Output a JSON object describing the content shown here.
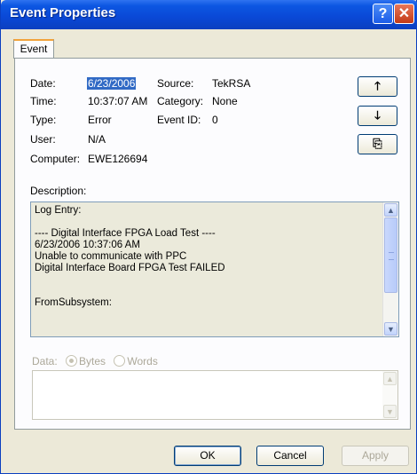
{
  "window": {
    "title": "Event Properties",
    "help_glyph": "?",
    "close_glyph": "✕"
  },
  "tabs": [
    {
      "label": "Event"
    }
  ],
  "event": {
    "date_label": "Date:",
    "date_value": "6/23/2006",
    "source_label": "Source:",
    "source_value": "TekRSA",
    "time_label": "Time:",
    "time_value": "10:37:07 AM",
    "category_label": "Category:",
    "category_value": "None",
    "type_label": "Type:",
    "type_value": "Error",
    "eventid_label": "Event ID:",
    "eventid_value": "0",
    "user_label": "User:",
    "user_value": "N/A",
    "computer_label": "Computer:",
    "computer_value": "EWE126694"
  },
  "side_buttons": {
    "up_glyph": "🡑",
    "down_glyph": "🡓",
    "copy_glyph": "⎘"
  },
  "description": {
    "label": "Description:",
    "lines": [
      "Log Entry:",
      "",
      "---- Digital Interface FPGA Load Test ----",
      "6/23/2006 10:37:06 AM",
      "Unable to communicate with PPC",
      "Digital Interface Board FPGA Test FAILED",
      "",
      "",
      "FromSubsystem:"
    ]
  },
  "data_section": {
    "label": "Data:",
    "option_bytes": "Bytes",
    "option_words": "Words",
    "selected": "Bytes"
  },
  "footer": {
    "ok_label": "OK",
    "cancel_label": "Cancel",
    "apply_label": "Apply"
  }
}
